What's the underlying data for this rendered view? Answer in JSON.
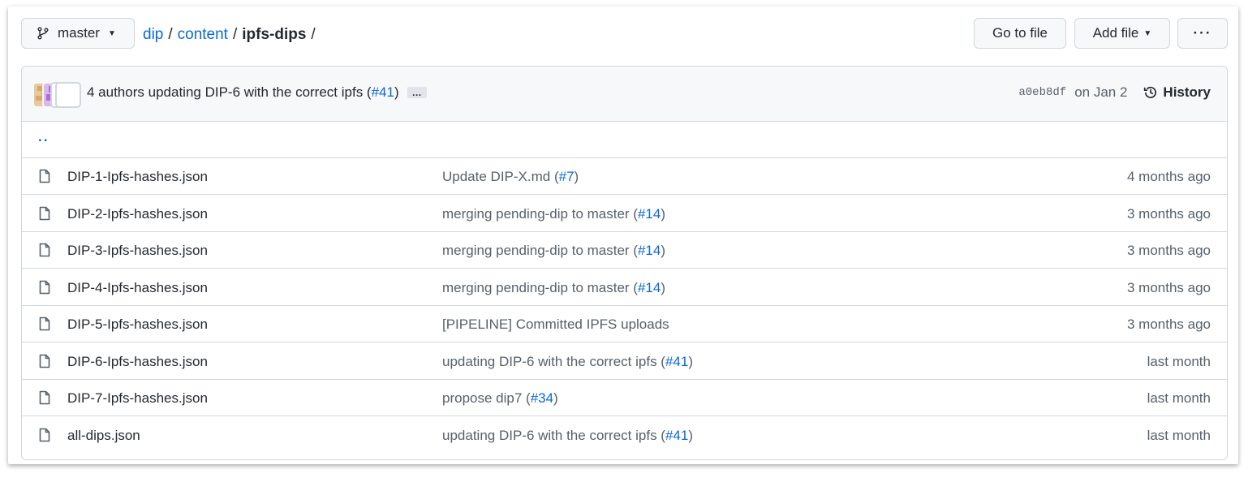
{
  "branch": {
    "label": "master"
  },
  "breadcrumb": {
    "root": "dip",
    "sep1": "/",
    "folder": "content",
    "sep2": "/",
    "current": "ipfs-dips",
    "sep3": "/"
  },
  "actions": {
    "goto_label": "Go to file",
    "addfile_label": "Add file",
    "more_label": "···"
  },
  "commit": {
    "authors": "4 authors",
    "message": "updating DIP-6 with the correct ipfs (",
    "pr": "#41",
    "close": ")",
    "ellipsis": "…",
    "sha": "a0eb8df",
    "date": "on Jan 2",
    "history_label": "History"
  },
  "parent": {
    "label": ".."
  },
  "files": [
    {
      "name": "DIP-1-Ipfs-hashes.json",
      "msg": "Update DIP-X.md (",
      "pr": "#7",
      "close": ")",
      "age": "4 months ago"
    },
    {
      "name": "DIP-2-Ipfs-hashes.json",
      "msg": "merging pending-dip to master (",
      "pr": "#14",
      "close": ")",
      "age": "3 months ago"
    },
    {
      "name": "DIP-3-Ipfs-hashes.json",
      "msg": "merging pending-dip to master (",
      "pr": "#14",
      "close": ")",
      "age": "3 months ago"
    },
    {
      "name": "DIP-4-Ipfs-hashes.json",
      "msg": "merging pending-dip to master (",
      "pr": "#14",
      "close": ")",
      "age": "3 months ago"
    },
    {
      "name": "DIP-5-Ipfs-hashes.json",
      "msg": "[PIPELINE] Committed IPFS uploads",
      "pr": "",
      "close": "",
      "age": "3 months ago"
    },
    {
      "name": "DIP-6-Ipfs-hashes.json",
      "msg": "updating DIP-6 with the correct ipfs (",
      "pr": "#41",
      "close": ")",
      "age": "last month"
    },
    {
      "name": "DIP-7-Ipfs-hashes.json",
      "msg": "propose dip7 (",
      "pr": "#34",
      "close": ")",
      "age": "last month"
    },
    {
      "name": "all-dips.json",
      "msg": "updating DIP-6 with the correct ipfs (",
      "pr": "#41",
      "close": ")",
      "age": "last month"
    }
  ],
  "colors": {
    "link": "#0969da",
    "muted": "#57606a",
    "border": "#d0d7de",
    "header_bg": "#f6f8fa"
  }
}
